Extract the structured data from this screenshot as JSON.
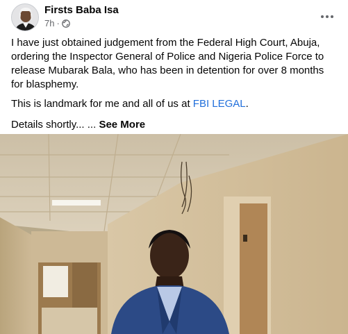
{
  "post": {
    "author": "Firsts Baba Isa",
    "time": "7h",
    "separator": "·",
    "paragraph1": "I have just obtained judgement from the Federal High Court, Abuja, ordering the Inspector General of Police and Nigeria Police Force to release Mubarak Bala, who has been in detention for over 8 months for blasphemy.",
    "paragraph2_before": "This is landmark for me and all of us at ",
    "paragraph2_link": "FBI LEGAL",
    "paragraph2_after": ".",
    "paragraph3": "Details shortly... ... ",
    "see_more": "See More",
    "privacy_icon": "globe-icon",
    "more_icon": "more-horizontal-icon",
    "link_color": "#216fdb"
  }
}
